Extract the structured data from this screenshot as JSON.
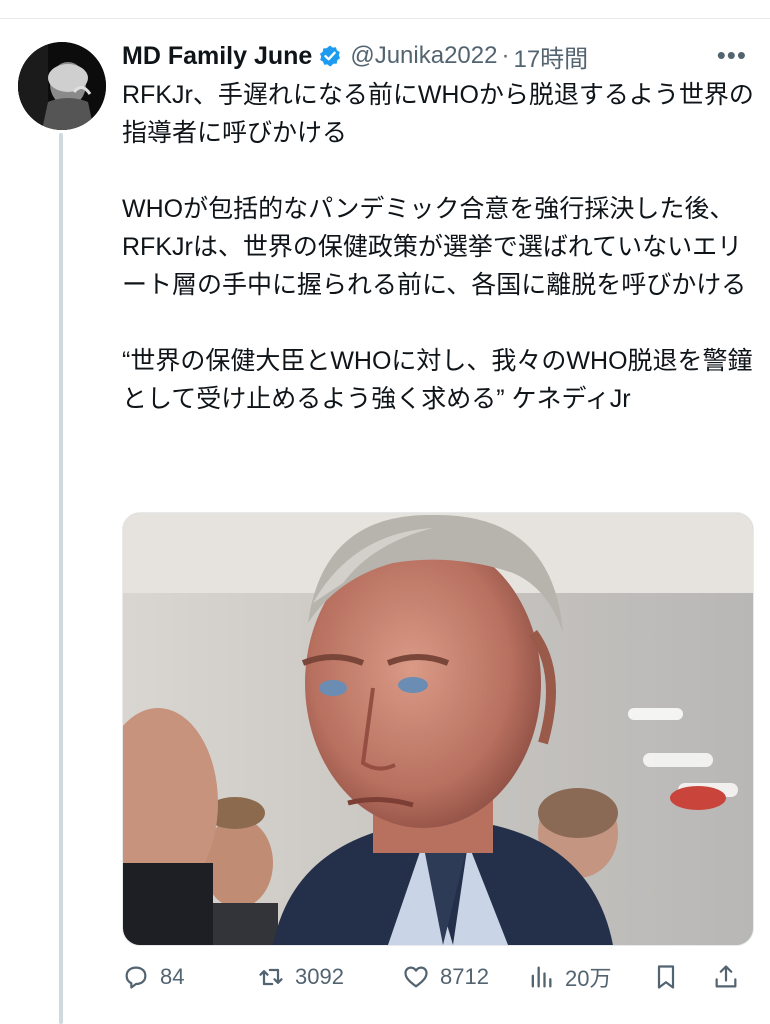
{
  "tweet": {
    "display_name": "MD Family June",
    "handle": "@Junika2022",
    "separator": "·",
    "time": "17時間",
    "more_label": "•••",
    "text_lines": {
      "p1": "RFKJr、手遅れになる前にWHOから脱退するよう世界の指導者に呼びかける",
      "p2": "WHOが包括的なパンデミック合意を強行採決した後、RFKJrは、世界の保健政策が選挙で選ばれていないエリート層の手中に握られる前に、各国に離脱を呼びかける",
      "p3": "“世界の保健大臣とWHOに対し、我々のWHO脱退を警鐘として受け止めるよう強く求める” ケネディJr"
    }
  },
  "actions": {
    "reply_count": "84",
    "retweet_count": "3092",
    "like_count": "8712",
    "views_count": "20万"
  },
  "icons": {
    "verified": "verified-badge-icon",
    "reply": "reply-icon",
    "retweet": "retweet-icon",
    "like": "heart-icon",
    "views": "views-chart-icon",
    "bookmark": "bookmark-icon",
    "share": "share-icon"
  },
  "colors": {
    "text": "#0f1419",
    "secondary": "#536471",
    "verified": "#1d9bf0",
    "thread_line": "#cfd9de"
  }
}
